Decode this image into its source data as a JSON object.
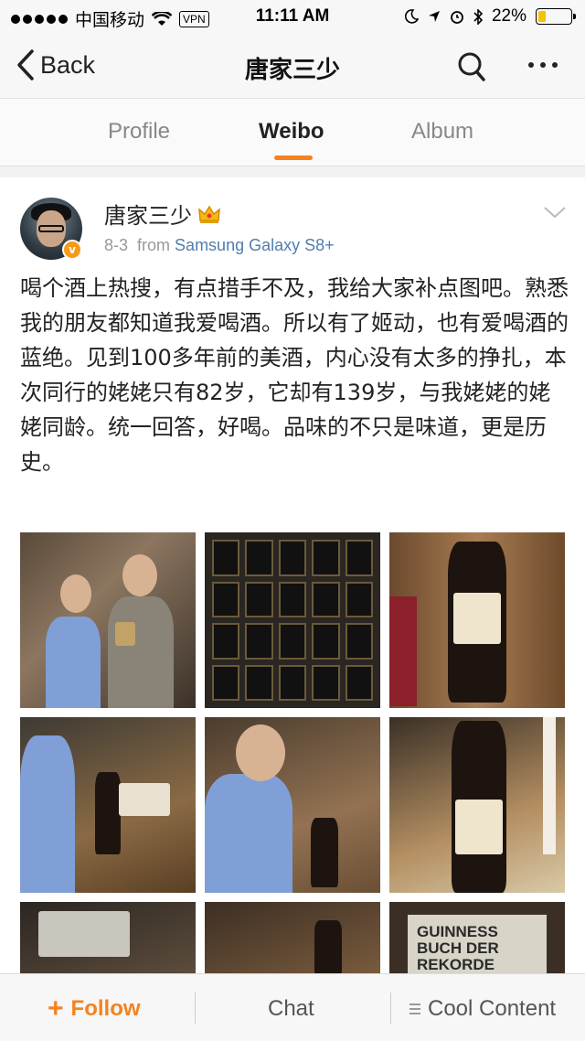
{
  "status_bar": {
    "carrier": "中国移动",
    "vpn": "VPN",
    "time": "11:11 AM",
    "battery": "22%"
  },
  "nav": {
    "back_label": "Back",
    "title": "唐家三少"
  },
  "tabs": [
    {
      "label": "Profile"
    },
    {
      "label": "Weibo"
    },
    {
      "label": "Album"
    }
  ],
  "post": {
    "username": "唐家三少",
    "date": "8-3",
    "from_label": "from",
    "source": "Samsung Galaxy S8+",
    "verified_badge": "v",
    "text": "喝个酒上热搜，有点措手不及，我给大家补点图吧。熟悉我的朋友都知道我爱喝酒。所以有了姬动，也有爱喝酒的蓝绝。见到100多年前的美酒，内心没有太多的挣扎，本次同行的姥姥只有82岁，它却有139岁，与我姥姥的姥姥同龄。统一回答，好喝。品味的不只是味道，更是历史。",
    "photo_book_title": "GUINNESS BUCH DER REKORDE"
  },
  "bottom_bar": {
    "follow_plus": "+",
    "follow": "Follow",
    "chat": "Chat",
    "cool_content": "Cool Content"
  },
  "colors": {
    "accent": "#f5821f",
    "link": "#507daf"
  }
}
